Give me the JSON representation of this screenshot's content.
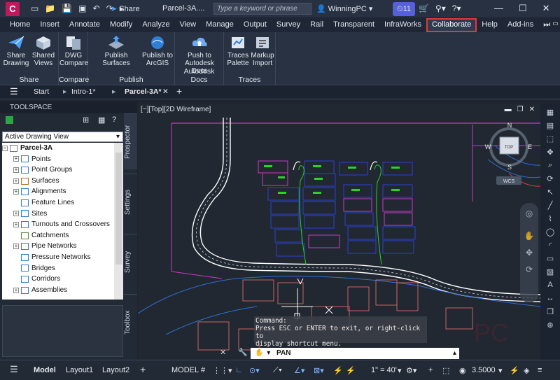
{
  "title_bar": {
    "app_letter": "C",
    "share_label": "Share",
    "document_title": "Parcel-3A....",
    "search_placeholder": "Type a keyword or phrase",
    "user_name": "WinningPC",
    "notification_count": "11"
  },
  "menu_tabs": [
    "Home",
    "Insert",
    "Annotate",
    "Modify",
    "Analyze",
    "View",
    "Manage",
    "Output",
    "Survey",
    "Rail",
    "Transparent",
    "InfraWorks",
    "Collaborate",
    "Help",
    "Add-ins"
  ],
  "active_menu_tab": "Collaborate",
  "ribbon": {
    "panels": [
      {
        "title": "Share",
        "buttons": [
          {
            "label": "Share Drawing",
            "icon": "paper-plane-icon"
          },
          {
            "label": "Shared Views",
            "icon": "shared-views-icon"
          }
        ]
      },
      {
        "title": "Compare",
        "buttons": [
          {
            "label": "DWG Compare",
            "icon": "dwg-compare-icon"
          }
        ]
      },
      {
        "title": "Publish",
        "buttons": [
          {
            "label": "Publish Surfaces",
            "icon": "publish-surfaces-icon"
          },
          {
            "label": "Publish to ArcGIS",
            "icon": "arcgis-icon"
          }
        ]
      },
      {
        "title": "Autodesk Docs",
        "buttons": [
          {
            "label": "Push to Autodesk Docs",
            "icon": "push-docs-icon"
          }
        ]
      },
      {
        "title": "Traces",
        "buttons": [
          {
            "label": "Traces Palette",
            "icon": "traces-palette-icon"
          },
          {
            "label": "Markup Import",
            "icon": "markup-import-icon"
          }
        ]
      }
    ]
  },
  "doc_tabs": [
    "Start",
    "Intro-1*",
    "Parcel-3A*"
  ],
  "active_doc_tab": "Parcel-3A*",
  "toolspace": {
    "title": "TOOLSPACE",
    "view_select": "Active Drawing View",
    "tree_root": "Parcel-3A",
    "tree_items": [
      {
        "label": "Points",
        "expander": "+"
      },
      {
        "label": "Point Groups",
        "expander": "+"
      },
      {
        "label": "Surfaces",
        "expander": "+"
      },
      {
        "label": "Alignments",
        "expander": "+"
      },
      {
        "label": "Feature Lines",
        "expander": ""
      },
      {
        "label": "Sites",
        "expander": "+"
      },
      {
        "label": "Turnouts and Crossovers",
        "expander": "+"
      },
      {
        "label": "Catchments",
        "expander": ""
      },
      {
        "label": "Pipe Networks",
        "expander": "+"
      },
      {
        "label": "Pressure Networks",
        "expander": ""
      },
      {
        "label": "Bridges",
        "expander": ""
      },
      {
        "label": "Corridors",
        "expander": ""
      },
      {
        "label": "Assemblies",
        "expander": "+"
      }
    ],
    "side_tabs": [
      "Prospector",
      "Settings",
      "Survey",
      "Toolbox"
    ]
  },
  "viewport": {
    "label": "[−][Top][2D Wireframe]",
    "viewcube_face": "TOP",
    "compass": {
      "n": "N",
      "s": "S",
      "e": "E",
      "w": "W"
    },
    "wcs_label": "WCS"
  },
  "command": {
    "tooltip_line1": "Command:",
    "tooltip_line2": "Press ESC or ENTER to exit, or right-click to",
    "tooltip_line3": "display shortcut menu.",
    "current": "PAN"
  },
  "status_bar": {
    "layout_tabs": [
      "Model",
      "Layout1",
      "Layout2"
    ],
    "active_layout": "Model",
    "model_label": "MODEL",
    "scale": "1\" = 40'",
    "value": "3.5000"
  }
}
